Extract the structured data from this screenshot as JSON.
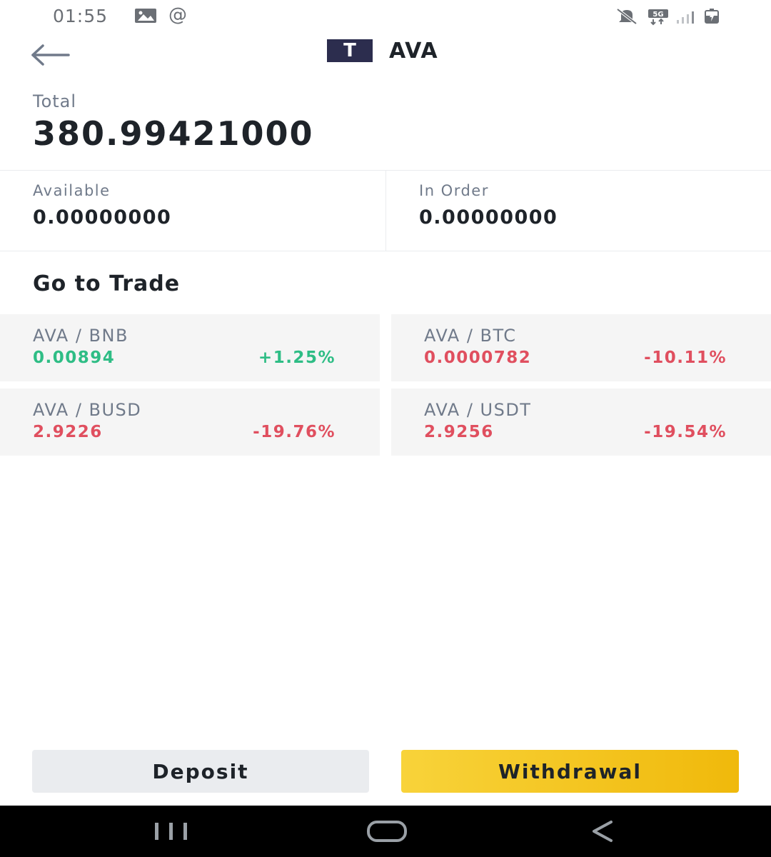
{
  "status_bar": {
    "time": "01:55",
    "icons": [
      "image-icon",
      "at-icon",
      "mute-icon",
      "5g-icon",
      "signal-icon",
      "battery-icon"
    ]
  },
  "header": {
    "coin_logo_letter": "T",
    "coin_name": "AVA",
    "icons": [
      "back-arrow-icon"
    ]
  },
  "total": {
    "label": "Total",
    "value": "380.99421000"
  },
  "balances": {
    "available_label": "Available",
    "available_value": "0.00000000",
    "in_order_label": "In Order",
    "in_order_value": "0.00000000"
  },
  "trade": {
    "title": "Go to Trade",
    "pairs": [
      {
        "name": "AVA / BNB",
        "price": "0.00894",
        "change": "+1.25%",
        "trend": "up"
      },
      {
        "name": "AVA / BTC",
        "price": "0.0000782",
        "change": "-10.11%",
        "trend": "down"
      },
      {
        "name": "AVA / BUSD",
        "price": "2.9226",
        "change": "-19.76%",
        "trend": "down"
      },
      {
        "name": "AVA / USDT",
        "price": "2.9256",
        "change": "-19.54%",
        "trend": "down"
      }
    ]
  },
  "actions": {
    "deposit_label": "Deposit",
    "withdrawal_label": "Withdrawal"
  },
  "nav_bar": {
    "icons": [
      "recent-apps-icon",
      "home-icon",
      "back-icon"
    ]
  },
  "colors": {
    "up": "#2ebd85",
    "down": "#e04f5f",
    "accent": "#f0b90b",
    "text_primary": "#1e2329",
    "text_secondary": "#707a8a"
  }
}
